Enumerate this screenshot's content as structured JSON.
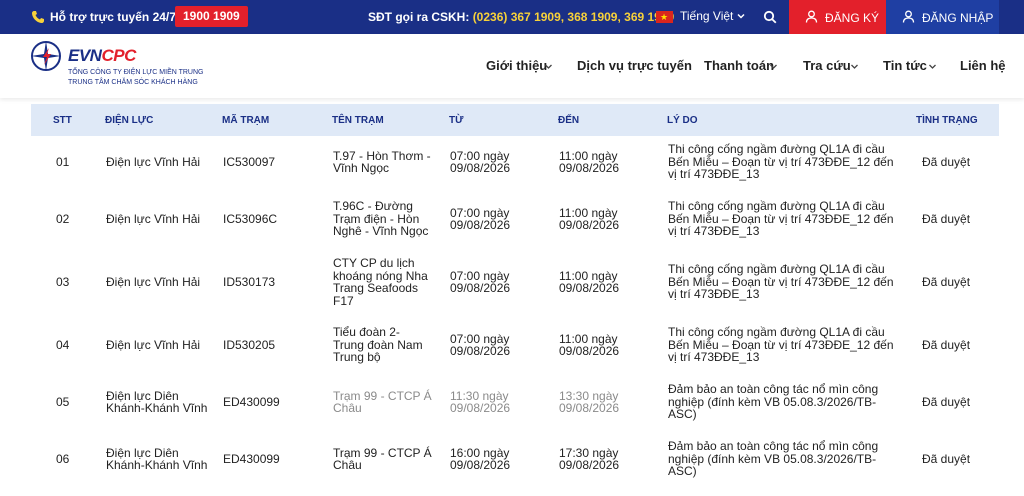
{
  "topbar": {
    "hotline_label": "Hỗ trợ trực tuyến 24/7:",
    "hotline_number": "1900 1909",
    "cskh_label": "SĐT gọi ra CSKH:",
    "cskh_numbers": "(0236) 367 1909, 368 1909, 369 1909",
    "language": "Tiếng Việt",
    "register_label": "ĐĂNG KÝ",
    "login_label": "ĐĂNG NHẬP"
  },
  "header": {
    "logo_part1": "EVN",
    "logo_part2": "CPC",
    "logo_sub1": "TỔNG CÔNG TY ĐIỆN LỰC MIỀN TRUNG",
    "logo_sub2": "TRUNG TÂM CHĂM SÓC KHÁCH HÀNG",
    "nav": [
      {
        "label": "Giới thiệu",
        "has_dropdown": true
      },
      {
        "label": "Dịch vụ trực tuyến",
        "has_dropdown": false
      },
      {
        "label": "Thanh toán",
        "has_dropdown": true
      },
      {
        "label": "Tra cứu",
        "has_dropdown": true
      },
      {
        "label": "Tin tức",
        "has_dropdown": true
      },
      {
        "label": "Liên hệ",
        "has_dropdown": false
      }
    ]
  },
  "table": {
    "headers": [
      "STT",
      "ĐIỆN LỰC",
      "MÃ TRẠM",
      "TÊN TRẠM",
      "TỪ",
      "ĐẾN",
      "LÝ DO",
      "TÌNH TRẠNG"
    ],
    "rows": [
      {
        "stt": "01",
        "dien_luc": [
          "Điện lực Vĩnh Hải"
        ],
        "ma_tram": "IC530097",
        "ten_tram": [
          "T.97 - Hòn Thơm -",
          "Vĩnh Ngọc"
        ],
        "tu": [
          "07:00 ngày",
          "09/08/2026"
        ],
        "den": [
          "11:00 ngày",
          "09/08/2026"
        ],
        "ly_do": [
          "Thi công cống ngầm đường QL1A đi cầu",
          "Bến Miễu – Đoạn từ vị trí 473ĐĐE_12 đến",
          "vị trí 473ĐĐE_13"
        ],
        "tinh_trang": "Đã duyệt"
      },
      {
        "stt": "02",
        "dien_luc": [
          "Điện lực Vĩnh Hải"
        ],
        "ma_tram": "IC53096C",
        "ten_tram": [
          "T.96C - Đường",
          "Trạm điện - Hòn",
          "Nghê - Vĩnh Ngọc"
        ],
        "tu": [
          "07:00 ngày",
          "09/08/2026"
        ],
        "den": [
          "11:00 ngày",
          "09/08/2026"
        ],
        "ly_do": [
          "Thi công cống ngầm đường QL1A đi cầu",
          "Bến Miễu – Đoạn từ vị trí 473ĐĐE_12 đến",
          "vị trí 473ĐĐE_13"
        ],
        "tinh_trang": "Đã duyệt"
      },
      {
        "stt": "03",
        "dien_luc": [
          "Điện lực Vĩnh Hải"
        ],
        "ma_tram": "ID530173",
        "ten_tram": [
          "CTY CP du lịch",
          "khoáng nóng Nha",
          "Trang Seafoods",
          "F17"
        ],
        "tu": [
          "07:00 ngày",
          "09/08/2026"
        ],
        "den": [
          "11:00 ngày",
          "09/08/2026"
        ],
        "ly_do": [
          "Thi công cống ngầm đường QL1A đi cầu",
          "Bến Miễu – Đoạn từ vị trí 473ĐĐE_12 đến",
          "vị trí 473ĐĐE_13"
        ],
        "tinh_trang": "Đã duyệt"
      },
      {
        "stt": "04",
        "dien_luc": [
          "Điện lực Vĩnh Hải"
        ],
        "ma_tram": "ID530205",
        "ten_tram": [
          "Tiểu đoàn 2-",
          "Trung đoàn Nam",
          "Trung bộ"
        ],
        "tu": [
          "07:00 ngày",
          "09/08/2026"
        ],
        "den": [
          "11:00 ngày",
          "09/08/2026"
        ],
        "ly_do": [
          "Thi công cống ngầm đường QL1A đi cầu",
          "Bến Miễu – Đoạn từ vị trí 473ĐĐE_12 đến",
          "vị trí 473ĐĐE_13"
        ],
        "tinh_trang": "Đã duyệt"
      },
      {
        "stt": "05",
        "dien_luc": [
          "Điện lực Diên",
          "Khánh-Khánh Vĩnh"
        ],
        "ma_tram": "ED430099",
        "ten_tram": [
          "Trạm 99 - CTCP Á",
          "Châu"
        ],
        "tu": [
          "11:30 ngày",
          "09/08/2026"
        ],
        "den": [
          "13:30 ngày",
          "09/08/2026"
        ],
        "ly_do": [
          "Đảm bảo an toàn công tác nổ mìn công",
          "nghiệp (đính kèm VB 05.08.3/2026/TB-",
          "ASC)"
        ],
        "tinh_trang": "Đã duyệt"
      },
      {
        "stt": "06",
        "dien_luc": [
          "Điện lực Diên",
          "Khánh-Khánh Vĩnh"
        ],
        "ma_tram": "ED430099",
        "ten_tram": [
          "Trạm 99 - CTCP Á",
          "Châu"
        ],
        "tu": [
          "16:00 ngày",
          "09/08/2026"
        ],
        "den": [
          "17:30 ngày",
          "09/08/2026"
        ],
        "ly_do": [
          "Đảm bảo an toàn công tác nổ mìn công",
          "nghiệp (đính kèm VB 05.08.3/2026/TB-",
          "ASC)"
        ],
        "tinh_trang": "Đã duyệt"
      }
    ]
  }
}
